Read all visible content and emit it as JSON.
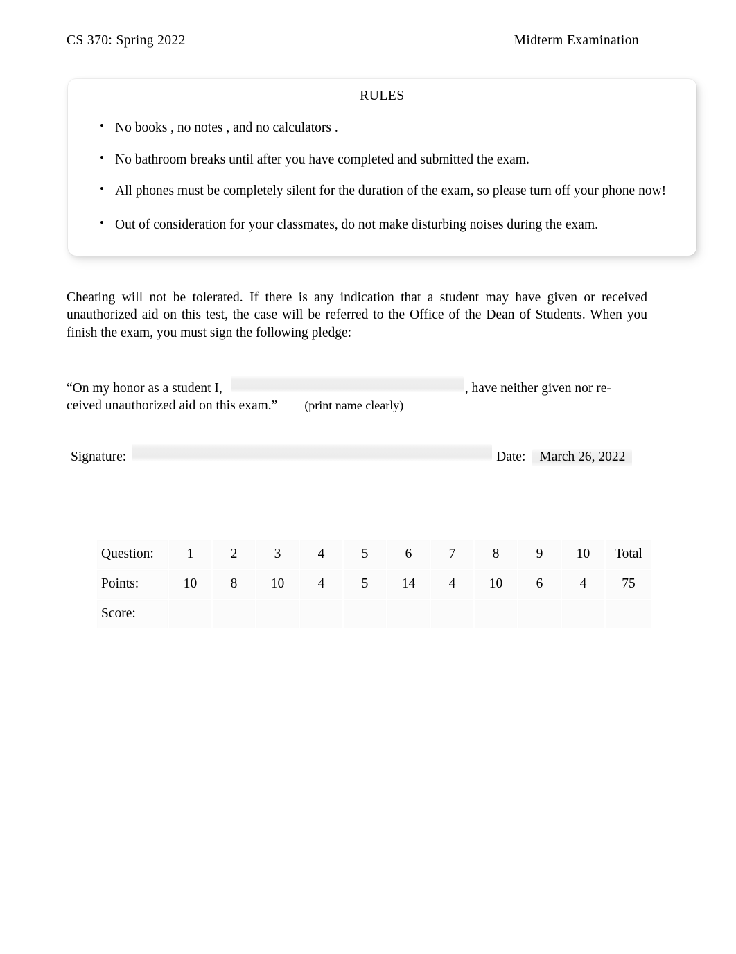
{
  "header": {
    "left": "CS 370: Spring 2022",
    "right": "Midterm Examination"
  },
  "rules": {
    "title": "RULES",
    "items": [
      "No books , no notes , and no calculators  .",
      "No bathroom breaks     until after you have completed and submitted the exam.",
      "All phones must be completely silent        for the duration of the exam, so please turn off your phone now!",
      "Out of consideration for your classmates, do not make disturbing noises during the exam."
    ],
    "bullet_glyph": "•"
  },
  "cheating_paragraph": "Cheating will not be tolerated.   If there is any indication that a student may have given or received unauthorized aid on this test, the case will be referred to the Office of the Dean of Students. When you finish the exam, you must sign the following pledge:",
  "pledge": {
    "before_blank": "“On my honor as a student I,",
    "name_field_value": "",
    "after_blank": ", have neither given nor re-",
    "line2": "ceived unauthorized aid on this exam.”",
    "print_note": "(print name clearly)"
  },
  "signature": {
    "label": "Signature:",
    "value": "",
    "date_label": "Date:",
    "date_value": "March 26, 2022"
  },
  "score_table": {
    "row_labels": [
      "Question:",
      "Points:",
      "Score:"
    ],
    "questions": [
      "1",
      "2",
      "3",
      "4",
      "5",
      "6",
      "7",
      "8",
      "9",
      "10"
    ],
    "total_header": "Total",
    "points": [
      "10",
      "8",
      "10",
      "4",
      "5",
      "14",
      "4",
      "10",
      "6",
      "4"
    ],
    "total_points": "75",
    "scores": [
      "",
      "",
      "",
      "",
      "",
      "",
      "",
      "",
      "",
      ""
    ],
    "total_score": ""
  },
  "colors": {
    "page_background": "#ffffff",
    "text": "#000000",
    "form_field": "#efefef",
    "table_cell": "#fbfbfb"
  }
}
